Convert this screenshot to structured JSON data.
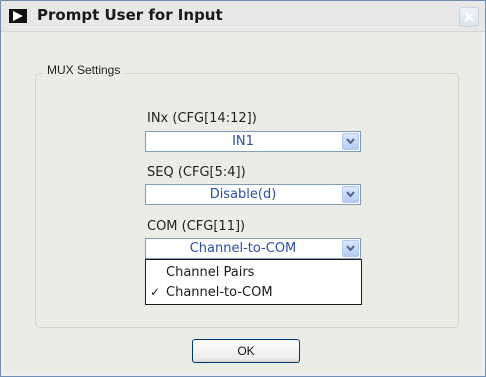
{
  "window": {
    "title": "Prompt User for Input",
    "title_icon": "play-icon",
    "close_icon": "close-icon"
  },
  "group": {
    "legend": "MUX Settings"
  },
  "fields": {
    "inx": {
      "label": "INx  (CFG[14:12])",
      "value": "IN1"
    },
    "seq": {
      "label": "SEQ  (CFG[5:4])",
      "value": "Disable(d)"
    },
    "com": {
      "label": "COM (CFG[11])",
      "value": "Channel-to-COM"
    }
  },
  "com_dropdown": {
    "options": [
      {
        "label": "Channel Pairs",
        "checked": false
      },
      {
        "label": "Channel-to-COM",
        "checked": true
      }
    ],
    "check_mark": "✓"
  },
  "buttons": {
    "ok": "OK"
  },
  "colors": {
    "value_text": "#2b4ea3",
    "arrow_button": "#b7ccf5",
    "close_disabled": "#c7d3e0"
  }
}
